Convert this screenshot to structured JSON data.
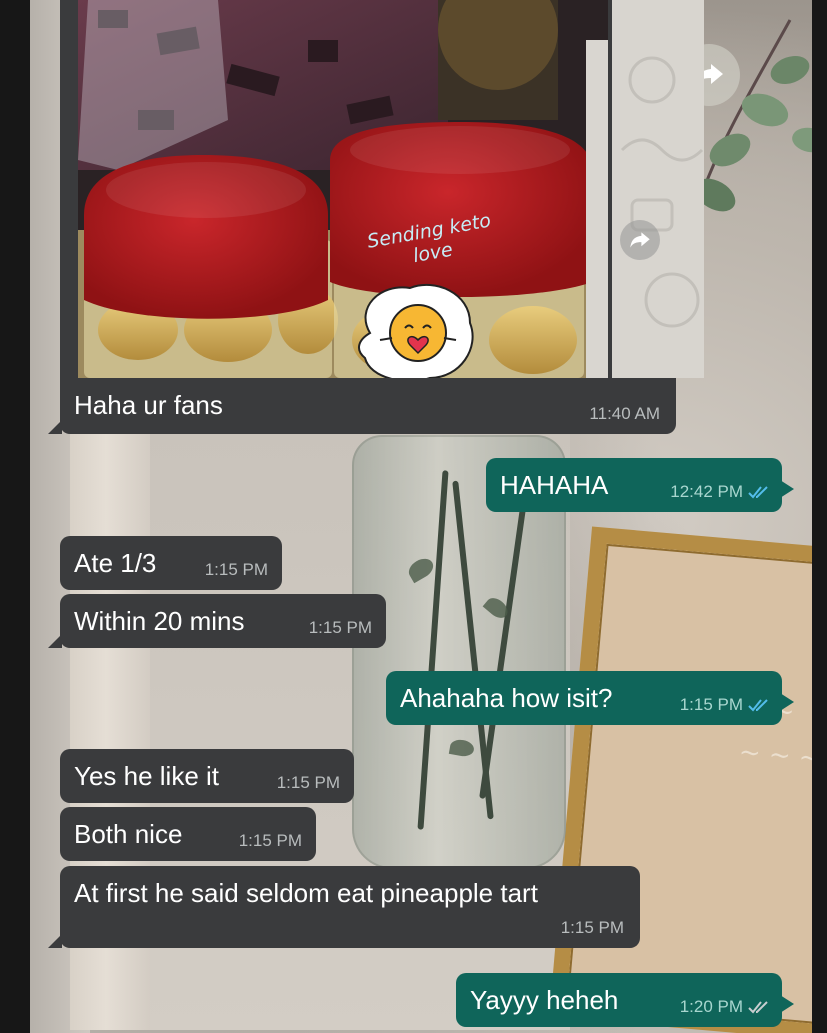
{
  "photo_message": {
    "sticker_text": "Sending keto love",
    "caption": "Haha ur fans",
    "time": "11:40 AM"
  },
  "messages": [
    {
      "id": "m1",
      "direction": "out",
      "text": "HAHAHA",
      "time": "12:42 PM",
      "status": "read"
    },
    {
      "id": "m2",
      "direction": "in",
      "text": "Ate 1/3",
      "time": "1:15 PM"
    },
    {
      "id": "m3",
      "direction": "in",
      "text": "Within 20 mins",
      "time": "1:15 PM"
    },
    {
      "id": "m4",
      "direction": "out",
      "text": "Ahahaha how isit?",
      "time": "1:15 PM",
      "status": "read"
    },
    {
      "id": "m5",
      "direction": "in",
      "text": "Yes he like it",
      "time": "1:15 PM"
    },
    {
      "id": "m6",
      "direction": "in",
      "text": "Both nice",
      "time": "1:15 PM"
    },
    {
      "id": "m7",
      "direction": "in",
      "text": "At first he said seldom eat pineapple tart",
      "time": "1:15 PM"
    },
    {
      "id": "m8",
      "direction": "out",
      "text": "Yayyy heheh",
      "time": "1:20 PM",
      "status": "delivered"
    }
  ],
  "colors": {
    "incoming_bubble": "#3a3b3d",
    "outgoing_bubble": "#0f655a",
    "read_ticks": "#53bdeb",
    "delivered_ticks": "#c9ced0"
  },
  "icons": {
    "forward": "forward-arrow-icon",
    "read_receipt": "double-check-icon"
  }
}
